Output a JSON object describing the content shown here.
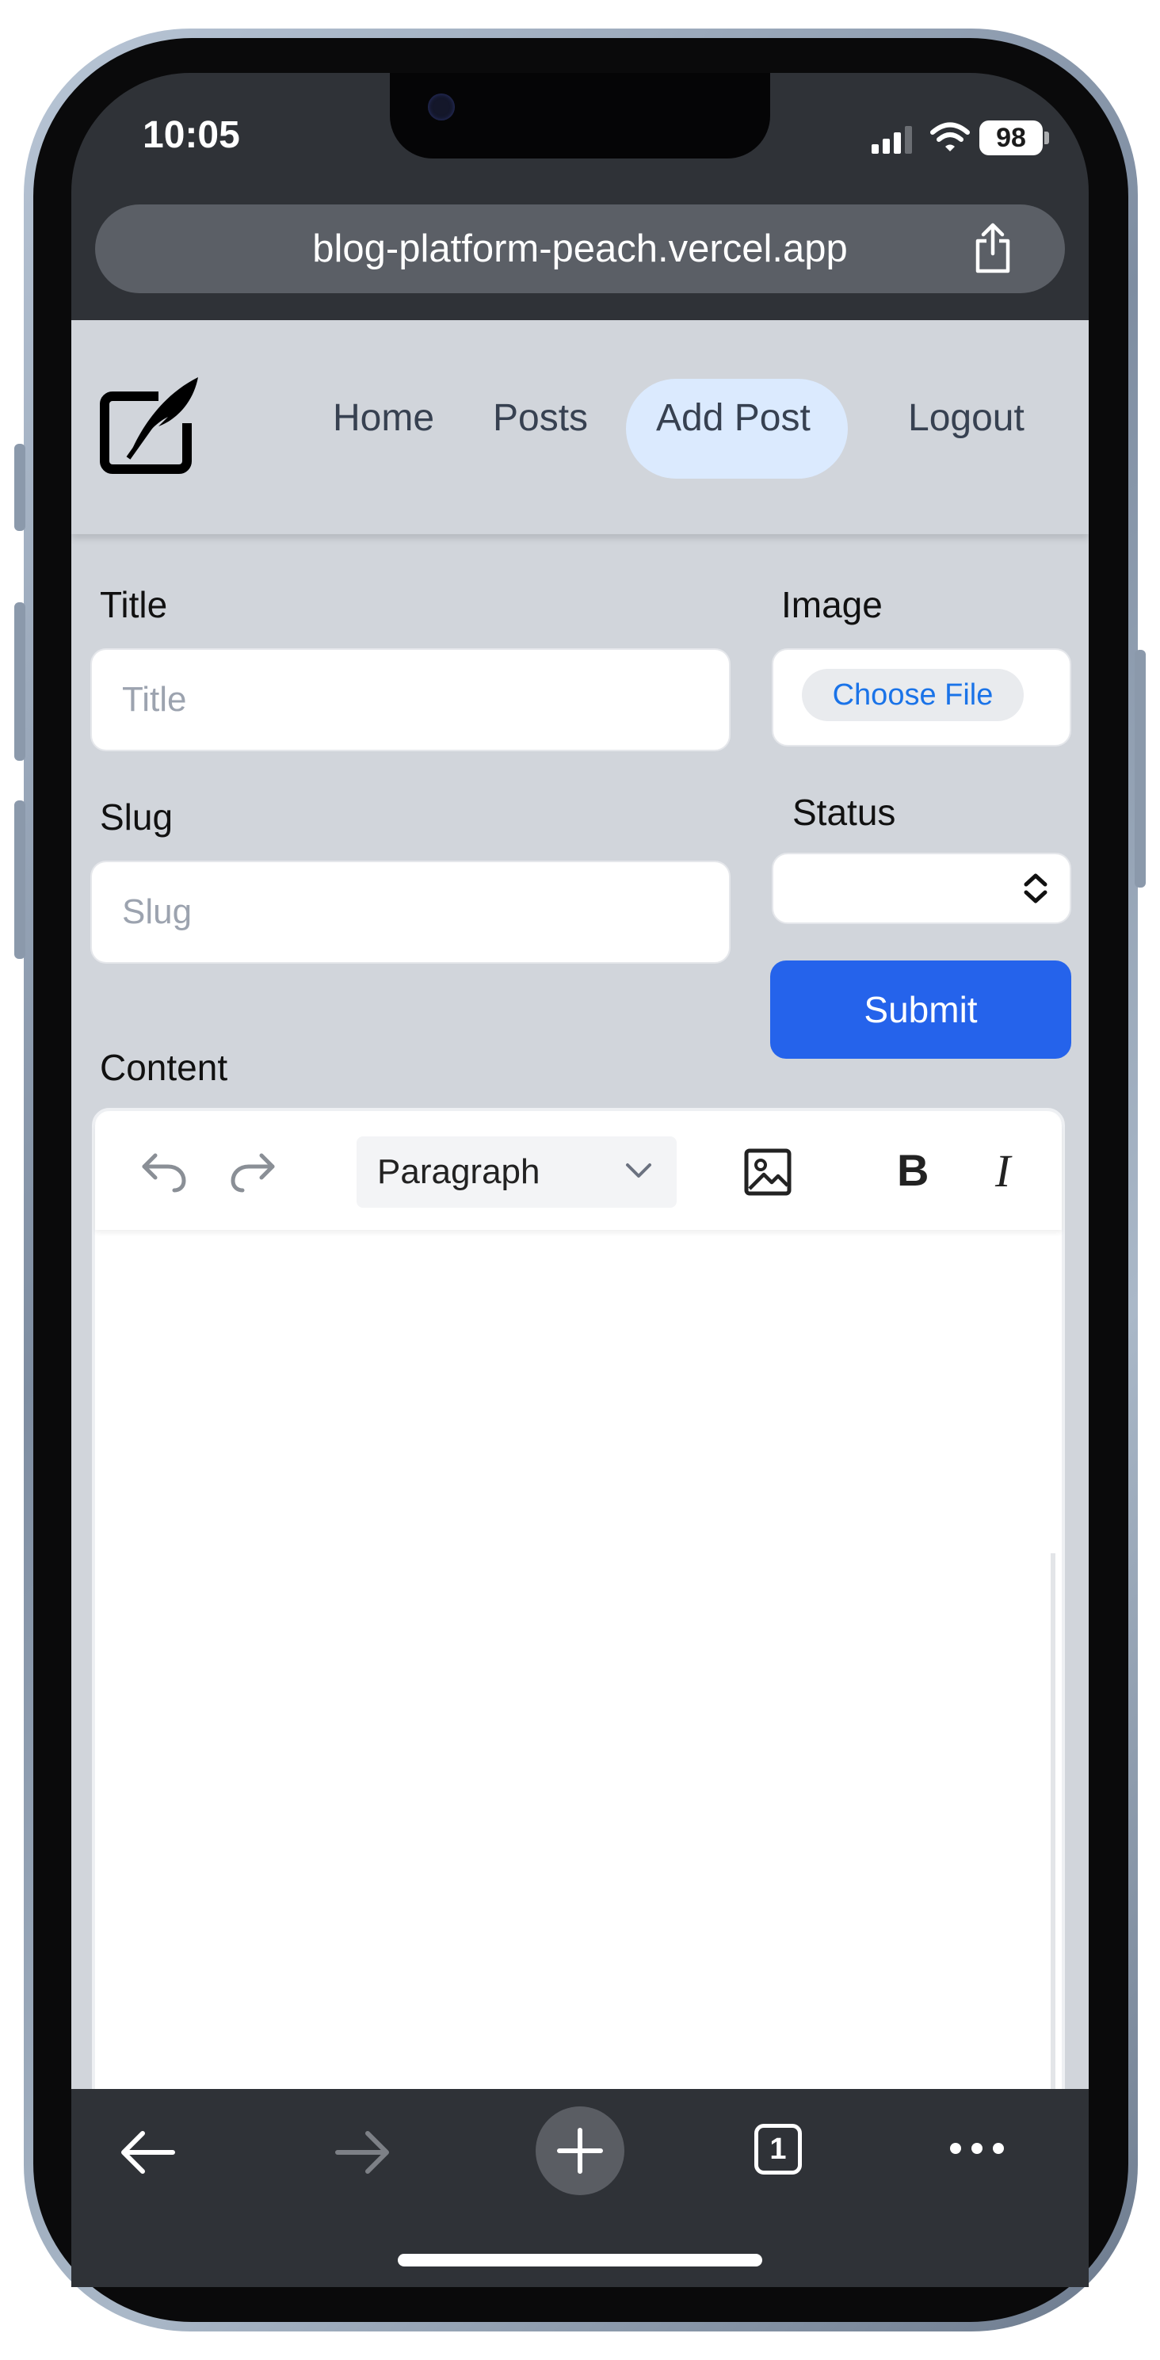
{
  "status_bar": {
    "time": "10:05",
    "battery": "98",
    "icons": [
      "signal-icon",
      "wifi-icon",
      "battery-icon"
    ]
  },
  "browser": {
    "url": "blog-platform-peach.vercel.app",
    "share_icon": "share-icon"
  },
  "nav": {
    "logo_icon": "quill-logo-icon",
    "links": [
      "Home",
      "Posts",
      "Add Post",
      "Logout"
    ],
    "active": "Add Post"
  },
  "form": {
    "title_label": "Title",
    "title_placeholder": "Title",
    "image_label": "Image",
    "choose_file": "Choose File",
    "slug_label": "Slug",
    "slug_placeholder": "Slug",
    "status_label": "Status",
    "status_value": "",
    "submit_label": "Submit",
    "content_label": "Content"
  },
  "editor_toolbar": {
    "block_format": "Paragraph",
    "icons": [
      "undo-icon",
      "redo-icon",
      "image-icon",
      "bold-icon",
      "italic-icon"
    ],
    "bold_glyph": "B",
    "italic_glyph": "I"
  },
  "browser_toolbar": {
    "tab_count": "1",
    "icons": [
      "back-icon",
      "forward-icon",
      "new-tab-icon",
      "tabs-icon",
      "more-icon"
    ]
  },
  "colors": {
    "accent": "#2563eb",
    "page_bg": "#d1d5db",
    "active_pill": "#dbeafe",
    "browser_chrome": "#2f3237"
  }
}
